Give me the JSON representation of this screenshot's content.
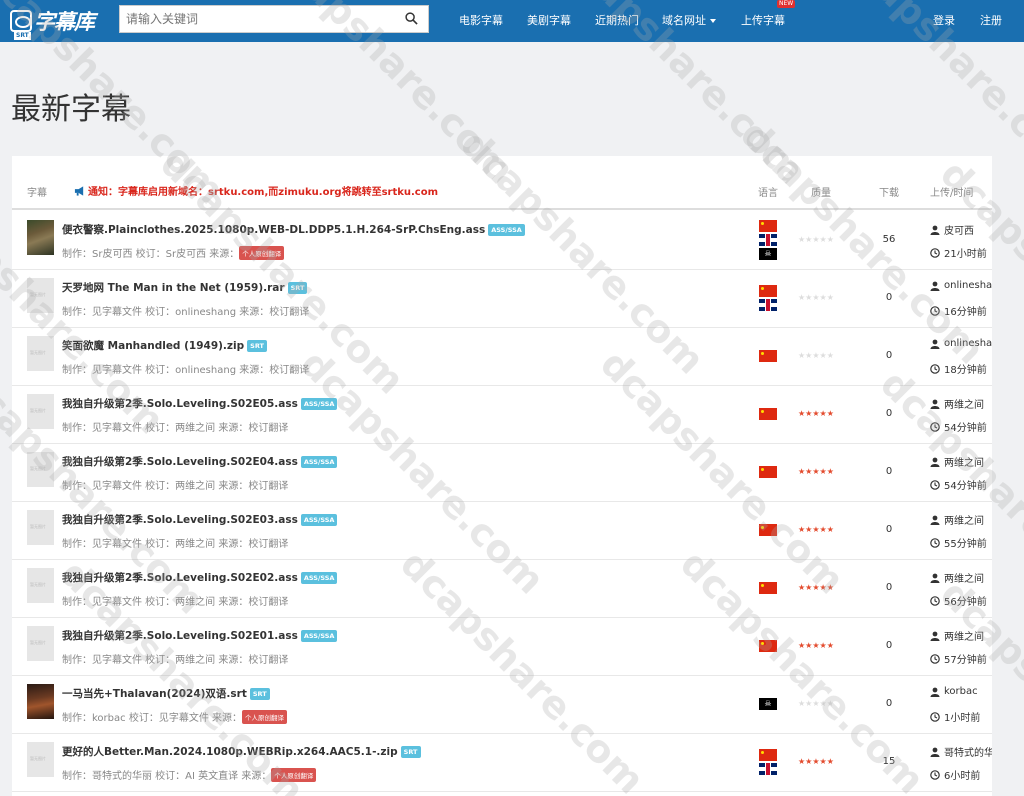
{
  "site": {
    "logo_text": "字幕库",
    "logo_sub": "SRT"
  },
  "search": {
    "placeholder": "请输入关键词"
  },
  "nav": {
    "items": [
      "电影字幕",
      "美剧字幕",
      "近期热门",
      "域名网址",
      "上传字幕"
    ],
    "new_badge": "NEW",
    "login": "登录",
    "register": "注册"
  },
  "page_title": "最新字幕",
  "table": {
    "col_subtitle": "字幕",
    "notice": "通知：字幕库启用新域名：srtku.com,而zimuku.org将跳转至srtku.com",
    "col_lang": "语言",
    "col_quality": "质量",
    "col_downloads": "下载",
    "col_uploader_time": "上传/时间"
  },
  "thumb_placeholder": "暂无图片",
  "rows": [
    {
      "title": "便衣警察.Plainclothes.2025.1080p.WEB-DL.DDP5.1.H.264-SrP.ChsEng.ass",
      "format": "ASS/SSA",
      "meta": "制作：Sr皮可西 校订：Sr皮可西 来源：",
      "source_badge": "个人原创翻译",
      "flags": [
        "cn",
        "uk",
        "pirate"
      ],
      "rating": 0,
      "downloads": "56",
      "uploader": "皮可西",
      "time": "21小时前",
      "poster": "poster1"
    },
    {
      "title": "天罗地网 The Man in the Net (1959).rar",
      "format": "SRT",
      "meta": "制作：见字幕文件 校订：onlineshang 来源：校订翻译",
      "source_badge": "",
      "flags": [
        "cn",
        "uk"
      ],
      "rating": 0,
      "downloads": "0",
      "uploader": "onlineshar",
      "time": "16分钟前",
      "poster": ""
    },
    {
      "title": "笑面欲魔 Manhandled (1949).zip",
      "format": "SRT",
      "meta": "制作：见字幕文件 校订：onlineshang 来源：校订翻译",
      "source_badge": "",
      "flags": [
        "cn"
      ],
      "rating": 0,
      "downloads": "0",
      "uploader": "onlineshar",
      "time": "18分钟前",
      "poster": ""
    },
    {
      "title": "我独自升级第2季.Solo.Leveling.S02E05.ass",
      "format": "ASS/SSA",
      "meta": "制作：见字幕文件 校订：两维之间 来源：校订翻译",
      "source_badge": "",
      "flags": [
        "cn"
      ],
      "rating": 5,
      "downloads": "0",
      "uploader": "两维之间",
      "time": "54分钟前",
      "poster": ""
    },
    {
      "title": "我独自升级第2季.Solo.Leveling.S02E04.ass",
      "format": "ASS/SSA",
      "meta": "制作：见字幕文件 校订：两维之间 来源：校订翻译",
      "source_badge": "",
      "flags": [
        "cn"
      ],
      "rating": 5,
      "downloads": "0",
      "uploader": "两维之间",
      "time": "54分钟前",
      "poster": ""
    },
    {
      "title": "我独自升级第2季.Solo.Leveling.S02E03.ass",
      "format": "ASS/SSA",
      "meta": "制作：见字幕文件 校订：两维之间 来源：校订翻译",
      "source_badge": "",
      "flags": [
        "cn"
      ],
      "rating": 5,
      "downloads": "0",
      "uploader": "两维之间",
      "time": "55分钟前",
      "poster": ""
    },
    {
      "title": "我独自升级第2季.Solo.Leveling.S02E02.ass",
      "format": "ASS/SSA",
      "meta": "制作：见字幕文件 校订：两维之间 来源：校订翻译",
      "source_badge": "",
      "flags": [
        "cn"
      ],
      "rating": 5,
      "downloads": "0",
      "uploader": "两维之间",
      "time": "56分钟前",
      "poster": ""
    },
    {
      "title": "我独自升级第2季.Solo.Leveling.S02E01.ass",
      "format": "ASS/SSA",
      "meta": "制作：见字幕文件 校订：两维之间 来源：校订翻译",
      "source_badge": "",
      "flags": [
        "cn"
      ],
      "rating": 5,
      "downloads": "0",
      "uploader": "两维之间",
      "time": "57分钟前",
      "poster": ""
    },
    {
      "title": "一马当先+Thalavan(2024)双语.srt",
      "format": "SRT",
      "meta": "制作：korbac 校订：见字幕文件 来源：",
      "source_badge": "个人原创翻译",
      "flags": [
        "pirate"
      ],
      "rating": 0,
      "downloads": "0",
      "uploader": "korbac",
      "time": "1小时前",
      "poster": "poster2"
    },
    {
      "title": "更好的人Better.Man.2024.1080p.WEBRip.x264.AAC5.1-.zip",
      "format": "SRT",
      "meta": "制作：哥特式的华丽 校订：AI 英文直译 来源：",
      "source_badge": "个人原创翻译",
      "flags": [
        "cn",
        "uk"
      ],
      "rating": 5,
      "downloads": "15",
      "uploader": "哥特式的华",
      "time": "6小时前",
      "poster": ""
    }
  ],
  "watermark": "dcapshare.com",
  "colors": {
    "navbar": "#1a6fb0",
    "notice": "#d9261c",
    "star_on": "#e34b2e",
    "badge_format": "#5bc0de",
    "badge_source": "#d9534f"
  }
}
